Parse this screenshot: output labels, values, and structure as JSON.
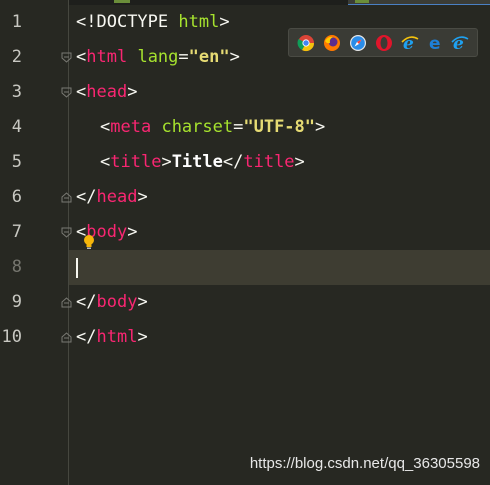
{
  "line_numbers": [
    "1",
    "2",
    "3",
    "4",
    "5",
    "6",
    "7",
    "8",
    "9",
    "10"
  ],
  "code": {
    "l1": {
      "lt": "<!",
      "kw": "DOCTYPE",
      "sp": " ",
      "html": "html",
      "gt": ">"
    },
    "l2": {
      "lt": "<",
      "tag": "html",
      "sp": " ",
      "attr": "lang",
      "eq": "=",
      "val": "\"en\"",
      "gt": ">"
    },
    "l3": {
      "lt": "<",
      "tag": "head",
      "gt": ">"
    },
    "l4": {
      "lt": "<",
      "tag": "meta",
      "sp": " ",
      "attr": "charset",
      "eq": "=",
      "val": "\"UTF-8\"",
      "gt": ">"
    },
    "l5": {
      "lt": "<",
      "tag": "title",
      "gt": ">",
      "text": "Title",
      "lt2": "</",
      "tag2": "title",
      "gt2": ">"
    },
    "l6": {
      "lt": "</",
      "tag": "head",
      "gt": ">"
    },
    "l7": {
      "lt": "<",
      "tag": "body",
      "gt": ">"
    },
    "l9": {
      "lt": "</",
      "tag": "body",
      "gt": ">"
    },
    "l10": {
      "lt": "</",
      "tag": "html",
      "gt": ">"
    }
  },
  "browser_icons": [
    "chrome-icon",
    "firefox-icon",
    "safari-icon",
    "opera-icon",
    "ie-icon",
    "edge-icon",
    "ie-icon"
  ],
  "watermark": "https://blog.csdn.net/qq_36305598",
  "colors": {
    "background": "#272822",
    "tag": "#f92672",
    "attribute": "#a6e22e",
    "string": "#e6db74",
    "current_line": "#3e3d32"
  }
}
